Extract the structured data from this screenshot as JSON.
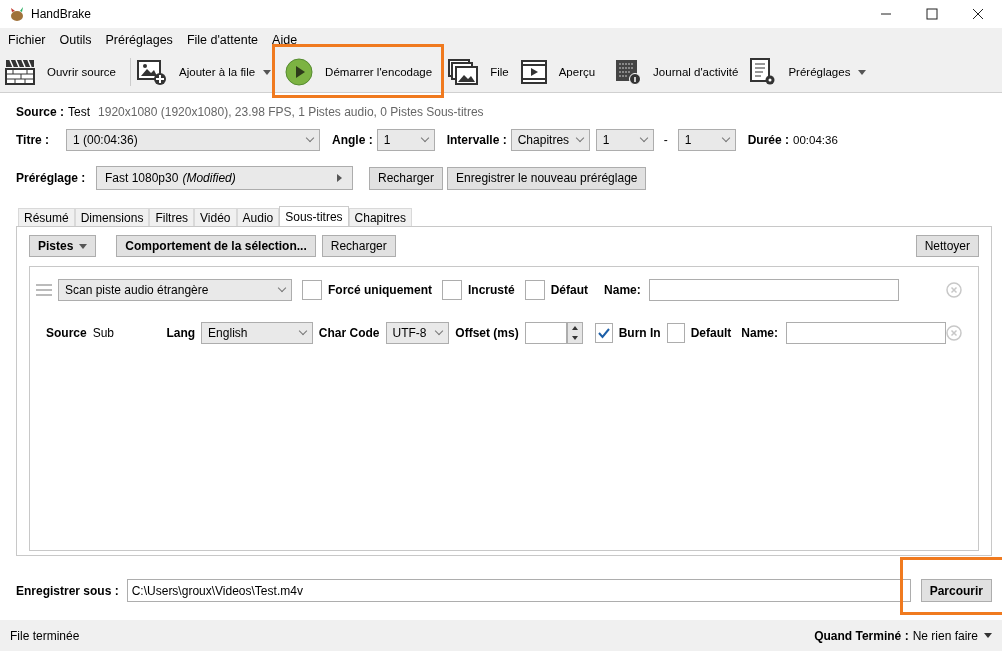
{
  "window": {
    "title": "HandBrake"
  },
  "menu": [
    "Fichier",
    "Outils",
    "Préréglages",
    "File d'attente",
    "Aide"
  ],
  "toolbar": [
    {
      "label": "Ouvrir source",
      "dropdown": false
    },
    {
      "label": "Ajouter à la file",
      "dropdown": true
    },
    {
      "label": "Démarrer l'encodage",
      "dropdown": false
    },
    {
      "label": "File",
      "dropdown": false
    },
    {
      "label": "Aperçu",
      "dropdown": false
    },
    {
      "label": "Journal d'activité",
      "dropdown": false
    },
    {
      "label": "Préréglages",
      "dropdown": true
    }
  ],
  "source": {
    "label": "Source :",
    "name": "Test",
    "info": "1920x1080 (1920x1080), 23.98 FPS, 1 Pistes audio, 0 Pistes Sous-titres"
  },
  "title_row": {
    "title_label": "Titre :",
    "title_value": "1  (00:04:36)",
    "angle_label": "Angle :",
    "angle_value": "1",
    "range_label": "Intervalle :",
    "range_mode": "Chapitres",
    "range_from": "1",
    "range_separator": "-",
    "range_to": "1",
    "duration_label": "Durée :",
    "duration_value": "00:04:36"
  },
  "preset": {
    "label": "Préréglage :",
    "value": "Fast 1080p30",
    "modified": "(Modified)",
    "buttons": [
      "Recharger",
      "Enregistrer le nouveau préréglage"
    ]
  },
  "tabs": [
    {
      "label": "Résumé",
      "selected": false
    },
    {
      "label": "Dimensions",
      "selected": false
    },
    {
      "label": "Filtres",
      "selected": false
    },
    {
      "label": "Vidéo",
      "selected": false
    },
    {
      "label": "Audio",
      "selected": false
    },
    {
      "label": "Sous-titres",
      "selected": true
    },
    {
      "label": "Chapitres",
      "selected": false
    }
  ],
  "subtitles": {
    "tracks_button": "Pistes",
    "behavior_button": "Comportement de la sélection...",
    "reload_button": "Recharger",
    "clear_button": "Nettoyer",
    "tracks": [
      {
        "kind": "scan",
        "track": "Scan piste audio étrangère",
        "options": [
          {
            "label": "Forcé uniquement",
            "checked": false
          },
          {
            "label": "Incrusté",
            "checked": false
          },
          {
            "label": "Défaut",
            "checked": false
          }
        ],
        "name_label": "Name:"
      },
      {
        "kind": "source",
        "source_label": "Source",
        "source_value": "Sub",
        "lang_label": "Lang",
        "lang_value": "English",
        "charcode_label": "Char Code",
        "charcode_value": "UTF-8",
        "offset_label": "Offset (ms)",
        "options": [
          {
            "label": "Burn In",
            "checked": true
          },
          {
            "label": "Default",
            "checked": false
          }
        ],
        "name_label": "Name:"
      }
    ]
  },
  "save": {
    "label": "Enregistrer sous :",
    "path": "C:\\Users\\groux\\Videos\\Test.m4v",
    "browse_button": "Parcourir"
  },
  "status_bar": {
    "text": "File terminée",
    "when_done_label": "Quand Terminé :",
    "when_done_value": "Ne rien faire"
  }
}
